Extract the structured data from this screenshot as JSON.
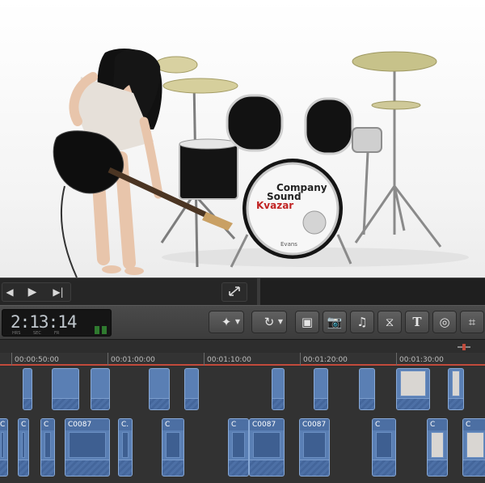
{
  "viewer": {
    "scene": "drummer-guitarist-video-frame",
    "logo_lines": [
      "Company",
      "Sound",
      "Kvazar"
    ],
    "drum_brand": "Evans"
  },
  "transport": {
    "prev_icon": "skip-back-icon",
    "play_icon": "play-icon",
    "next_icon": "skip-forward-icon",
    "fullscreen_icon": "fullscreen-icon"
  },
  "timecode": {
    "value": "2:13:14",
    "units": [
      "HRS",
      "SEC",
      "FR"
    ]
  },
  "toolbar": {
    "tools": [
      {
        "name": "magic-wand-tool",
        "glyph": "✦"
      },
      {
        "name": "retime-tool",
        "glyph": "↻"
      },
      {
        "name": "clip-appearance-tool",
        "glyph": "▣"
      },
      {
        "name": "photo-browser-tool",
        "glyph": "📷"
      },
      {
        "name": "music-browser-tool",
        "glyph": "♫"
      },
      {
        "name": "transitions-tool",
        "glyph": "⧖"
      },
      {
        "name": "titles-tool",
        "glyph": "T"
      },
      {
        "name": "generators-tool",
        "glyph": "◎"
      },
      {
        "name": "themes-tool",
        "glyph": "⌗"
      }
    ]
  },
  "ruler": {
    "labels": [
      "00:00:50:00",
      "00:01:00:00",
      "00:01:10:00",
      "00:01:20:00",
      "00:01:30:00"
    ]
  },
  "clips": {
    "top_row": [
      "",
      "",
      "",
      "",
      "",
      "",
      "",
      "",
      ""
    ],
    "bottom_row": [
      "C",
      "C",
      "C",
      "C0087",
      "C.",
      "C",
      "C",
      "C0087",
      "C0087",
      "C",
      "C",
      "C"
    ]
  },
  "colors": {
    "clip": "#5a7fb4",
    "playhead": "#c24b3c",
    "toolbar": "#444444"
  }
}
